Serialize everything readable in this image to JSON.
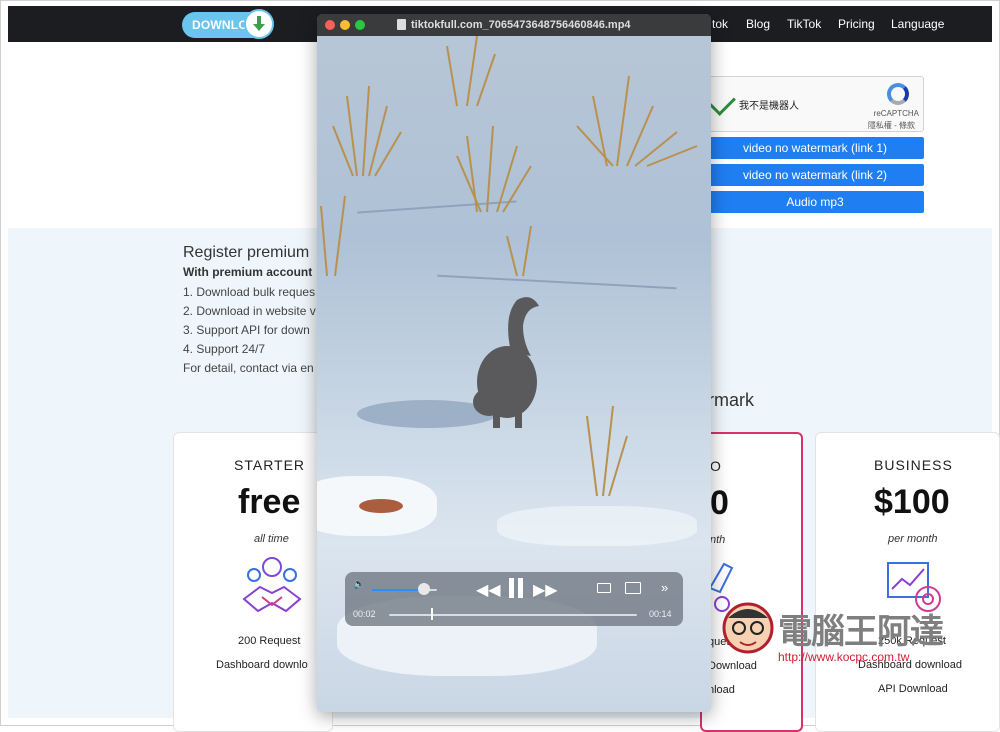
{
  "navbar": {
    "logo_text": "DOWNLOAD",
    "links": [
      "tok",
      "Blog",
      "TikTok",
      "Pricing",
      "Language"
    ]
  },
  "captcha": {
    "label": "我不是機器人",
    "brand": "reCAPTCHA",
    "sub": "隱私權 - 條款"
  },
  "download_buttons": [
    "video no watermark (link 1)",
    "video no watermark (link 2)",
    "Audio mp3"
  ],
  "register": {
    "title": "Register premium",
    "subtitle": "With premium account",
    "lines": [
      "1. Download bulk reques",
      "2. Download in website v",
      "3. Support API for down",
      "4. Support 24/7",
      "For detail, contact via en"
    ]
  },
  "section_heading": "rmark",
  "plans": {
    "starter": {
      "name": "STARTER",
      "price": "free",
      "period": "all time",
      "features": [
        "200 Request",
        "Dashboard downlo"
      ]
    },
    "pro": {
      "name": "O",
      "price": "0",
      "period": "nth",
      "features": [
        "quest",
        "Download",
        "nload"
      ]
    },
    "business": {
      "name": "BUSINESS",
      "price": "$100",
      "period": "per month",
      "features": [
        "250k Request",
        "Dashboard download",
        "API Download"
      ]
    }
  },
  "video": {
    "filename": "tiktokfull.com_7065473648756460846.mp4",
    "current_time": "00:02",
    "duration": "00:14",
    "progress_fraction": 0.17,
    "volume_fraction": 0.8
  },
  "stamp": {
    "brand": "電腦王阿達",
    "url": "http://www.kocpc.com.tw"
  },
  "colors": {
    "navbar": "#1b1d21",
    "button_blue": "#1f7ef2",
    "pro_border": "#d6336c",
    "logo_blue": "#6ac4ec"
  }
}
